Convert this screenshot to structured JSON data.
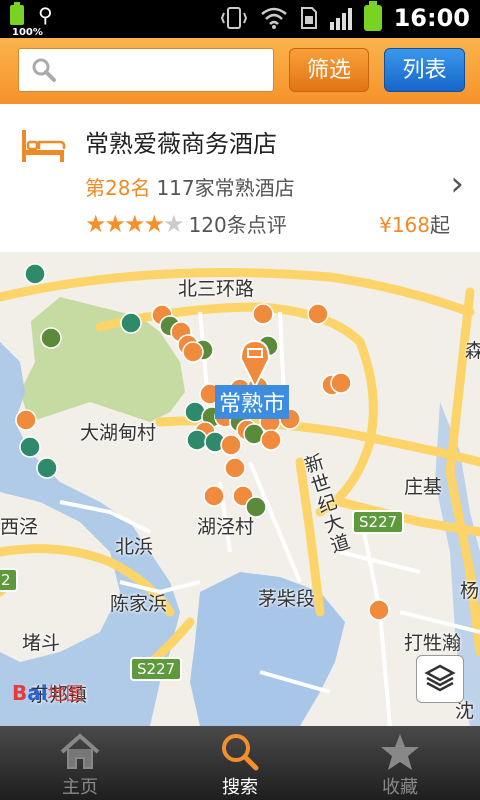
{
  "status_bar": {
    "battery_left_pct": "100%",
    "time": "16:00"
  },
  "toolbar": {
    "search_value": "",
    "filter_label": "筛选",
    "list_label": "列表"
  },
  "hotel": {
    "name": "常熟爱薇商务酒店",
    "rank": "第28名",
    "rank_text": "117家常熟酒店",
    "stars_filled": "★★★★",
    "stars_empty": "★",
    "rating_stars": 4,
    "reviews": "120条点评",
    "price_symbol": "¥",
    "price_amount": "168",
    "price_suffix": "起"
  },
  "map": {
    "labels": {
      "beisanhuan": "北三环路",
      "changshu": "常熟市",
      "dahudian": "大湖甸村",
      "xinshiji": "新世纪大道",
      "zhuangji": "庄基",
      "hujingcun": "湖泾村",
      "xijing": "西泾",
      "beibin": "北浜",
      "chenjiabang": "陈家浜",
      "maochaiduan": "茅柴段",
      "yang": "杨",
      "dadouluo": "打牲瀚",
      "dudou": "堵斗",
      "dongbangzhen": "东邦镇",
      "yuan": "森",
      "shen": "沈"
    },
    "road_badges": {
      "s227_a": "S227",
      "s227_b": "S227",
      "left_edge": "2"
    },
    "logo": {
      "b": "B",
      "du": "ai",
      "ditu": "地图"
    },
    "colors": {
      "orange_marker": "#f08a3c",
      "green_marker": "#5a8a3a",
      "teal_marker": "#2e8a6a",
      "road": "#fcd46a",
      "water": "#a8c6e8",
      "park": "#c5dba2"
    }
  },
  "tabs": [
    {
      "label": "主页",
      "icon": "home-icon",
      "active": false
    },
    {
      "label": "搜索",
      "icon": "search-icon",
      "active": true
    },
    {
      "label": "收藏",
      "icon": "star-icon",
      "active": false
    }
  ]
}
